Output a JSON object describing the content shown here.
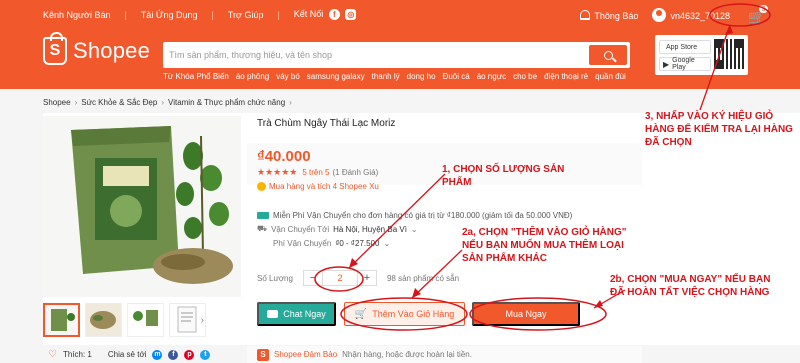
{
  "topbar": {
    "seller_center": "Kênh Người Bán",
    "download_app": "Tải Ứng Dụng",
    "help": "Trợ Giúp",
    "connect": "Kết Nối",
    "notifications": "Thông Báo",
    "username": "vn4632_70128",
    "cart_count": "3"
  },
  "brand": {
    "logo_text": "Shopee",
    "logo_glyph": "S",
    "accent": "#f1582c"
  },
  "search": {
    "placeholder": "Tìm sản phẩm, thương hiệu, và tên shop",
    "keywords": [
      "Từ Khóa Phổ Biến",
      "áo phông",
      "váy bó",
      "samsung galaxy",
      "thanh lý",
      "dong ho",
      "Đuôi cá",
      "áo ngực",
      "cho be",
      "điện thoại rẻ",
      "quần đùi"
    ]
  },
  "app_download": {
    "app_store": "App Store",
    "google_play": "Google Play"
  },
  "breadcrumb": [
    "Shopee",
    "Sức Khỏe & Sắc Đẹp",
    "Vitamin & Thực phẩm chức năng"
  ],
  "product": {
    "title": "Trà Chùm Ngây Thái Lạc Moriz",
    "price": "₫40.000",
    "rating_value": "5 trên 5",
    "rating_count": "(1 Đánh Giá)",
    "coin_text": "Mua hàng và tích 4 Shopee Xu",
    "free_ship": "Miễn Phí Vận Chuyển cho đơn hàng có giá trị từ ₫180.000 (giảm tối đa 50.000 VNĐ)",
    "ship_to_label": "Vận Chuyển Tới",
    "ship_to_value": "Hà Nội, Huyện Ba Vì",
    "ship_fee_label": "Phí Vận Chuyển",
    "ship_fee_value": "₫0 - ₫27.500",
    "qty_label": "Số Lượng",
    "qty_value": "2",
    "stock": "98 sản phẩm có sẵn",
    "chat_button": "Chat Ngay",
    "add_to_cart_button": "Thêm Vào Giỏ Hàng",
    "buy_now_button": "Mua Ngay"
  },
  "footer": {
    "likes": "Thích: 1",
    "share": "Chia sẻ tới",
    "guarantee_title": "Shopee Đảm Bảo",
    "guarantee_desc": "Nhận hàng, hoặc được hoàn lại tiền."
  },
  "annotations": {
    "step1": "1, CHỌN SỐ LƯỢNG SẢN PHẨM",
    "step2a": "2a, CHỌN \"THÊM VÀO GIỎ HÀNG\" NẾU BẠN MUỐN MUA THÊM LOẠI SẢN PHẨM KHÁC",
    "step2b": "2b, CHỌN \"MUA NGAY\" NẾU BẠN ĐÃ HOÀN TẤT VIỆC CHỌN HÀNG",
    "step3": "3, NHẤP VÀO KÝ HIỆU GIỎ HÀNG ĐỂ KIỂM TRA LẠI HÀNG ĐÃ CHỌN",
    "color": "#d6141a"
  }
}
